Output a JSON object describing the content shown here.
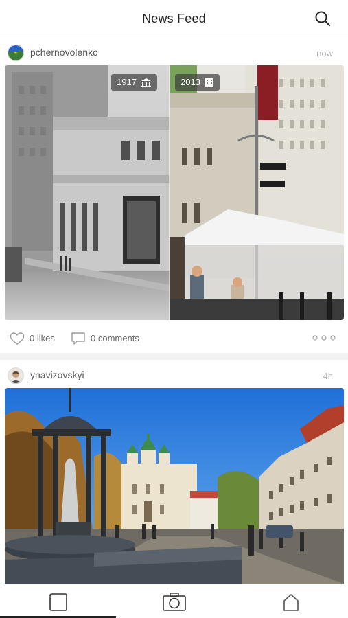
{
  "header": {
    "title": "News Feed",
    "search_icon": "search-icon"
  },
  "posts": [
    {
      "username": "pchernovolenko",
      "time": "now",
      "photo": {
        "left_year": "1917",
        "right_year": "2013",
        "left_icon": "building-icon",
        "right_icon": "building-icon"
      },
      "likes": "0 likes",
      "comments": "0 comments"
    },
    {
      "username": "ynavizovskyi",
      "time": "4h"
    }
  ],
  "tabbar": {
    "items": [
      {
        "icon": "feed-square-icon",
        "active": true
      },
      {
        "icon": "camera-icon",
        "active": false
      },
      {
        "icon": "home-icon",
        "active": false
      }
    ]
  },
  "colors": {
    "accent": "#222222",
    "muted": "#b5b5b5",
    "separator": "#f1f1f1"
  }
}
